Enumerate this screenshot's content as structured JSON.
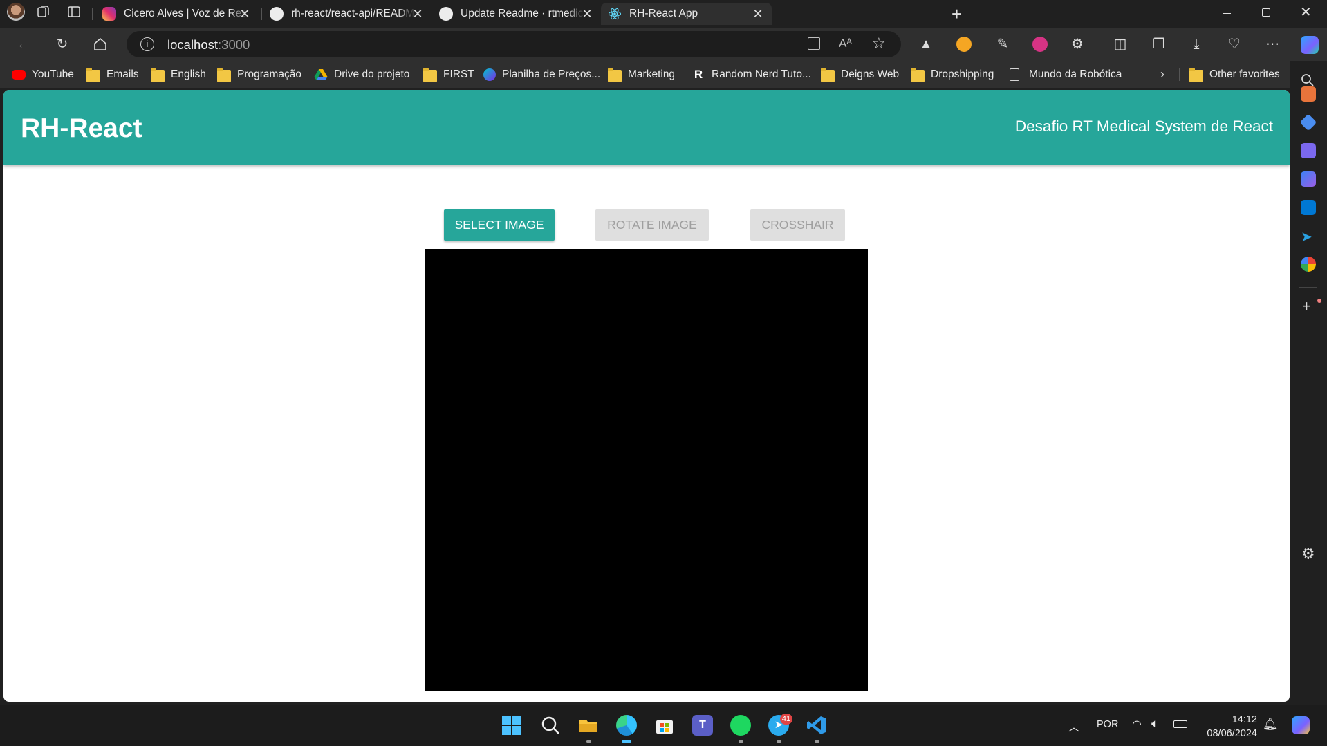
{
  "browser": {
    "tabs": [
      {
        "title": "Cicero Alves | Voz de Respeito (@",
        "icon": "instagram-icon",
        "active": false
      },
      {
        "title": "rh-react/react-api/README.md a",
        "icon": "github-icon",
        "active": false
      },
      {
        "title": "Update Readme · rtmedical/vaga",
        "icon": "github-icon",
        "active": false
      },
      {
        "title": "RH-React App",
        "icon": "react-icon",
        "active": true
      }
    ],
    "address": {
      "host": "localhost",
      "port": ":3000"
    },
    "favorites": [
      {
        "label": "YouTube",
        "icon": "youtube-icon"
      },
      {
        "label": "Emails",
        "icon": "folder-icon"
      },
      {
        "label": "English",
        "icon": "folder-icon"
      },
      {
        "label": "Programação",
        "icon": "folder-icon"
      },
      {
        "label": "Drive do projeto",
        "icon": "google-drive-icon"
      },
      {
        "label": "FIRST",
        "icon": "folder-icon"
      },
      {
        "label": "Planilha de Preços...",
        "icon": "canva-icon"
      },
      {
        "label": "Marketing",
        "icon": "folder-icon"
      },
      {
        "label": "Random Nerd Tuto...",
        "icon": "r-logo-icon"
      },
      {
        "label": "Deigns Web",
        "icon": "folder-icon"
      },
      {
        "label": "Dropshipping",
        "icon": "folder-icon"
      },
      {
        "label": "Mundo da Robótica",
        "icon": "page-icon"
      }
    ],
    "other_favorites": "Other favorites"
  },
  "app": {
    "title": "RH-React",
    "subtitle": "Desafio RT Medical System de React",
    "buttons": {
      "select_image": "Select Image",
      "rotate_image": "Rotate Image",
      "crosshair": "Crosshair"
    }
  },
  "taskbar": {
    "telegram_badge": "41",
    "language": "POR",
    "time": "14:12",
    "date": "08/06/2024"
  },
  "colors": {
    "accent": "#26a69a",
    "disabled_bg": "#dfdfdf",
    "disabled_text": "#9f9f9f"
  }
}
